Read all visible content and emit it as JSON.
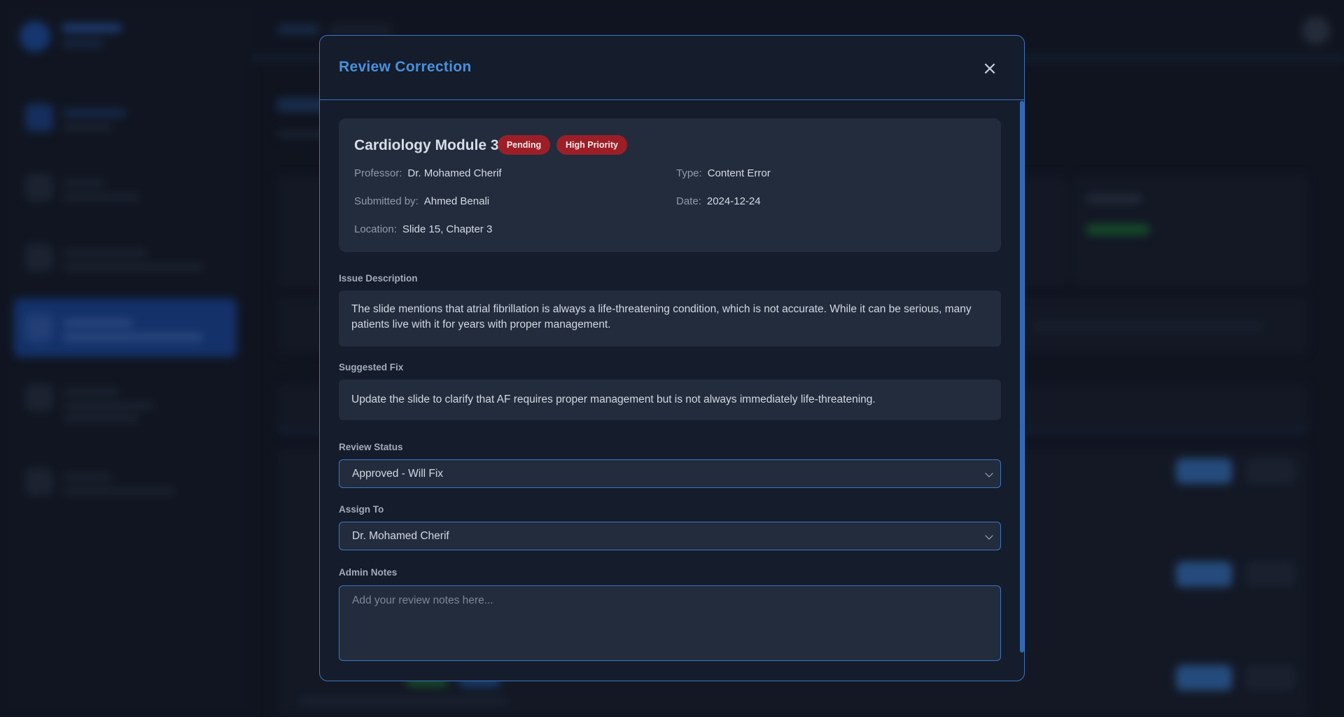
{
  "modal": {
    "title": "Review Correction",
    "close_icon": "×"
  },
  "summary": {
    "title": "Cardiology Module 3",
    "status_badge": "Pending",
    "priority_badge": "High Priority",
    "fields": [
      {
        "label": "Professor:",
        "value": "Dr. Mohamed Cherif"
      },
      {
        "label": "Type:",
        "value": "Content Error"
      },
      {
        "label": "Submitted by:",
        "value": "Ahmed Benali"
      },
      {
        "label": "Date:",
        "value": "2024-12-24"
      },
      {
        "label": "Location:",
        "value": "Slide 15, Chapter 3"
      }
    ]
  },
  "issue": {
    "label": "Issue Description",
    "text": "The slide mentions that atrial fibrillation is always a life-threatening condition, which is not accurate. While it can be serious, many patients live with it for years with proper management."
  },
  "fix": {
    "label": "Suggested Fix",
    "text": "Update the slide to clarify that AF requires proper management but is not always immediately life-threatening."
  },
  "review_status": {
    "label": "Review Status",
    "selected": "Approved - Will Fix"
  },
  "assign_to": {
    "label": "Assign To",
    "selected": "Dr. Mohamed Cherif"
  },
  "admin_notes": {
    "label": "Admin Notes",
    "placeholder": "Add your review notes here..."
  },
  "colors": {
    "accent": "#3b76c2",
    "title": "#4a90dd",
    "badge": "#9c1f28",
    "background": "#141a27",
    "panel": "#222c3d"
  }
}
